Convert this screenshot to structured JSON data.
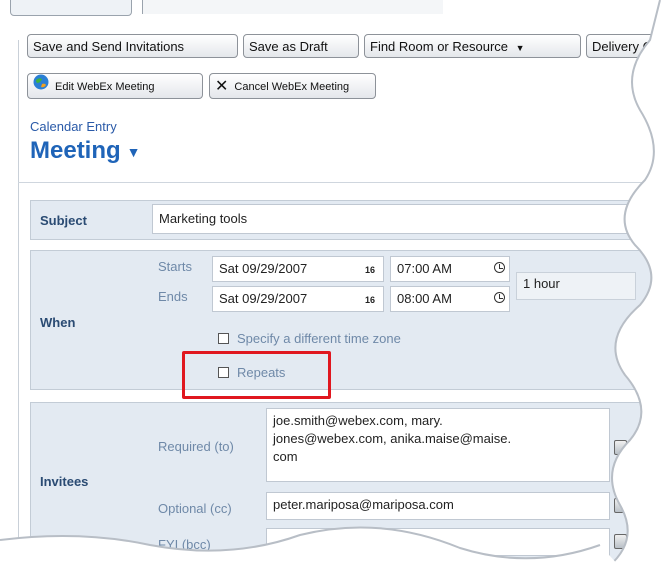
{
  "toolbar": {
    "save_send": "Save and Send Invitations",
    "save_draft": "Save as Draft",
    "find_room": "Find Room or Resource",
    "delivery": "Delivery O"
  },
  "webex": {
    "edit": "Edit WebEx Meeting",
    "cancel": "Cancel WebEx Meeting"
  },
  "header": {
    "crumb": "Calendar Entry",
    "title": "Meeting"
  },
  "subject": {
    "label": "Subject",
    "value": "Marketing tools"
  },
  "when": {
    "label": "When",
    "starts_label": "Starts",
    "ends_label": "Ends",
    "start_date": "Sat 09/29/2007",
    "end_date": "Sat 09/29/2007",
    "calendar_day": "16",
    "start_time": "07:00 AM",
    "end_time": "08:00 AM",
    "duration": "1 hour",
    "timezone_label": "Specify a different time zone",
    "repeats_label": "Repeats"
  },
  "invitees": {
    "label": "Invitees",
    "required_label": "Required (to)",
    "required_value_l1": "joe.smith@webex.com, mary.",
    "required_value_l2": "jones@webex.com, anika.maise@maise.",
    "required_value_l3": "com",
    "optional_label": "Optional (cc)",
    "optional_value": "peter.mariposa@mariposa.com",
    "fyi_label": "FYI (bcc)"
  }
}
